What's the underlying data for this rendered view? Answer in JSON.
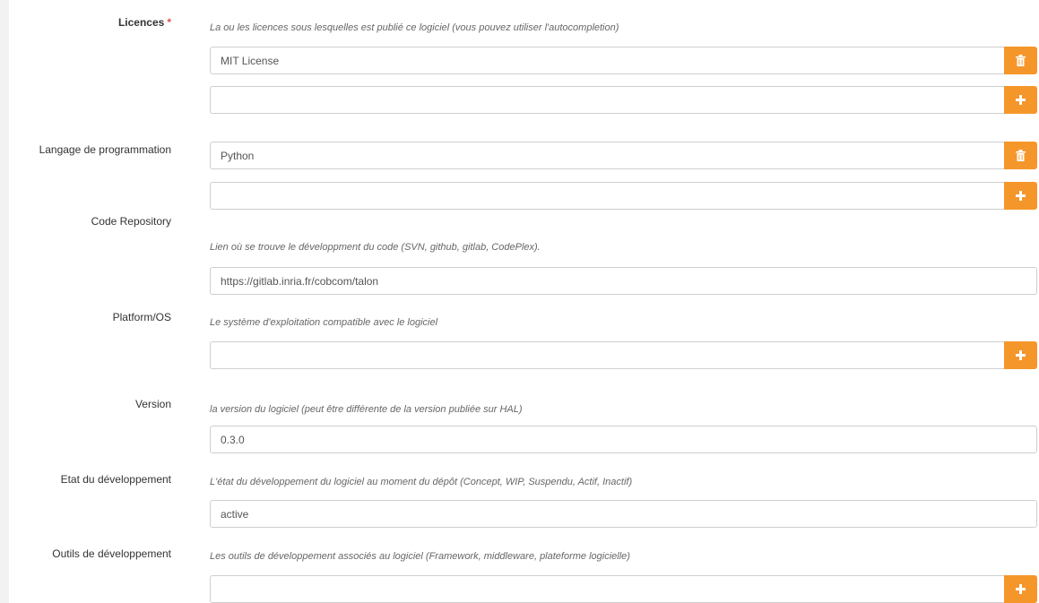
{
  "colors": {
    "accent": "#f5962a",
    "required": "#d9534f"
  },
  "licences": {
    "label": "Licences",
    "required_mark": "*",
    "help": "La ou les licences sous lesquelles est publié ce logiciel (vous pouvez utiliser l'autocompletion)",
    "values": [
      "MIT License",
      ""
    ],
    "icons": [
      "trash-icon",
      "plus-icon"
    ]
  },
  "langage": {
    "label": "Langage de programmation",
    "values": [
      "Python",
      ""
    ],
    "icons": [
      "trash-icon",
      "plus-icon"
    ]
  },
  "code_repository": {
    "label": "Code Repository",
    "help": "Lien où se trouve le développment du code (SVN, github, gitlab, CodePlex).",
    "value": "https://gitlab.inria.fr/cobcom/talon"
  },
  "platform": {
    "label": "Platform/OS",
    "help": "Le système d'exploitation compatible avec le logiciel",
    "value": "",
    "icon": "plus-icon"
  },
  "version": {
    "label": "Version",
    "help": "la version du logiciel (peut être différente de la version publiée sur HAL)",
    "value": "0.3.0"
  },
  "etat": {
    "label": "Etat du développement",
    "help": "L'état du développement du logiciel au moment du dépôt (Concept, WIP, Suspendu, Actif, Inactif)",
    "value": "active"
  },
  "outils": {
    "label": "Outils de développement",
    "help": "Les outils de développement associés au logiciel (Framework, middleware, plateforme logicielle)",
    "value": "",
    "icon": "plus-icon"
  }
}
